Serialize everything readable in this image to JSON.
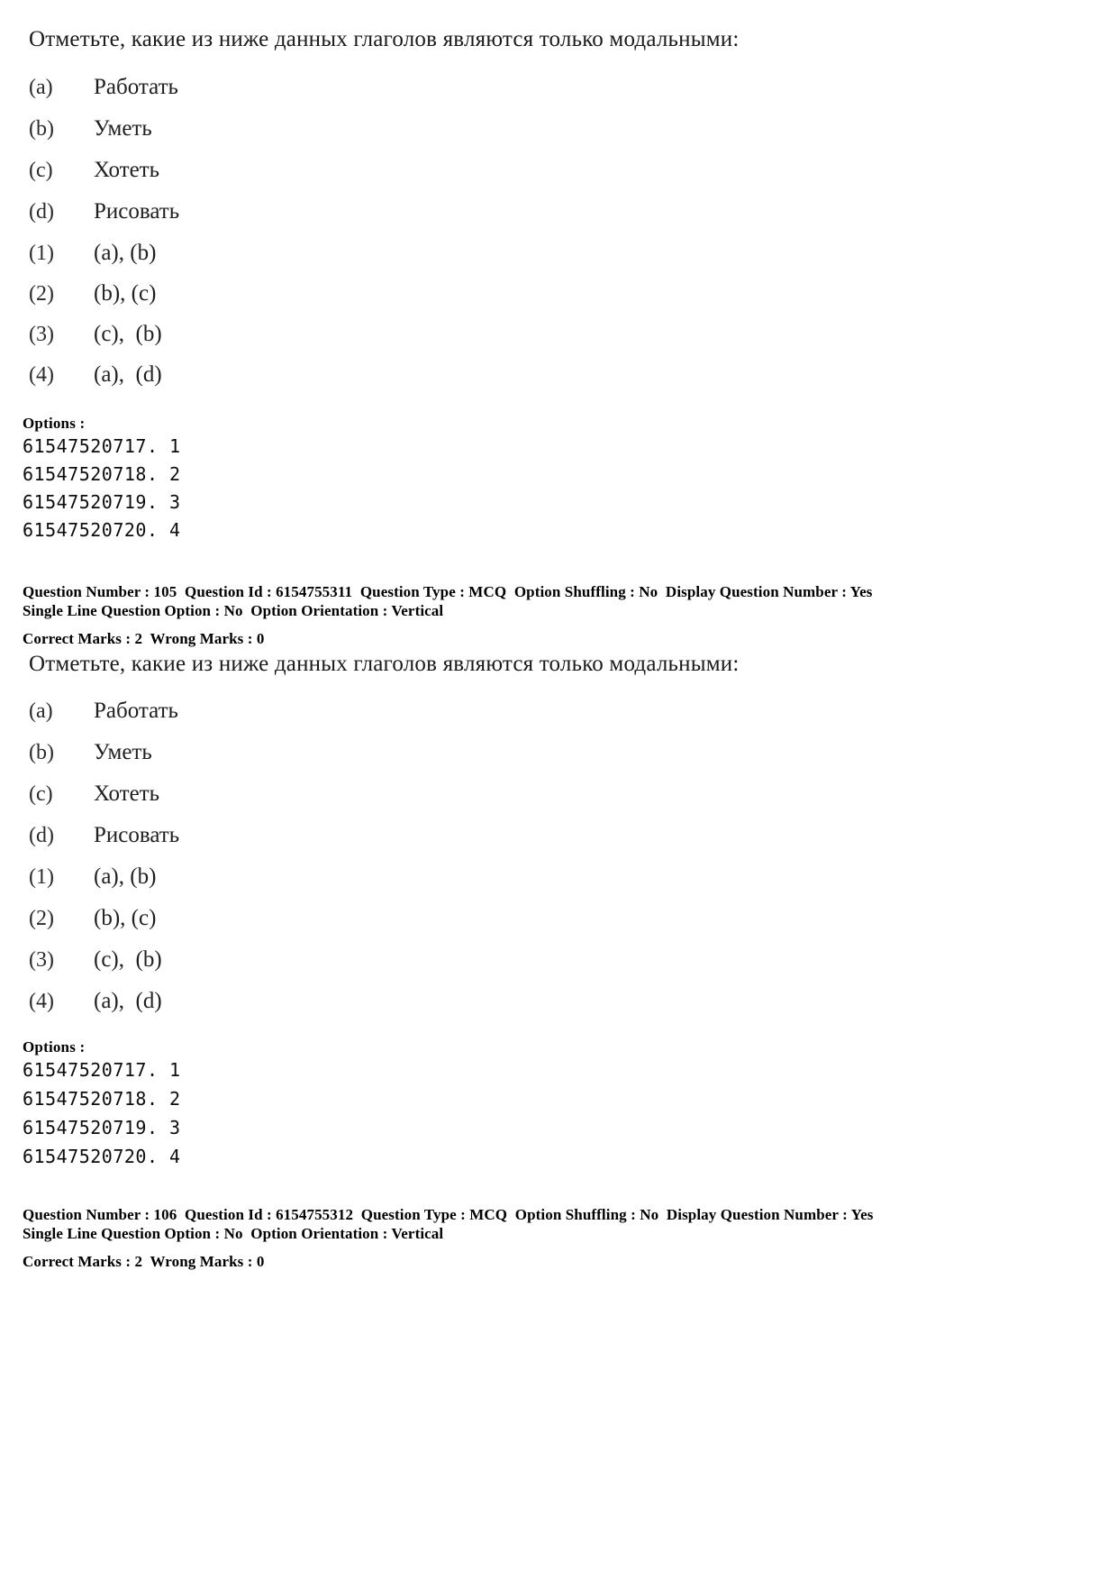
{
  "document": {
    "type": "exam-question-paper",
    "language_sample": "Russian",
    "page_background": "#ffffff",
    "text_color": "#000000"
  },
  "questions": [
    {
      "stem": "Отметьте, какие из ниже данных глаголов являются только модальными:",
      "sub_items": [
        {
          "label": "(a)",
          "text": "Работать"
        },
        {
          "label": "(b)",
          "text": "Уметь"
        },
        {
          "label": "(c)",
          "text": "Хотеть"
        },
        {
          "label": "(d)",
          "text": "Рисовать"
        }
      ],
      "choices": [
        {
          "label": "(1)",
          "text": "(a), (b)"
        },
        {
          "label": "(2)",
          "text": "(b), (c)"
        },
        {
          "label": "(3)",
          "text": "(c),  (b)"
        },
        {
          "label": "(4)",
          "text": "(a),  (d)"
        }
      ],
      "options_header": "Options :",
      "option_ids": [
        "61547520717. 1",
        "61547520718. 2",
        "61547520719. 3",
        "61547520720. 4"
      ],
      "meta": {
        "line1": "Question Number : 105  Question Id : 6154755311  Question Type : MCQ  Option Shuffling : No  Display Question Number : Yes",
        "line2": "Single Line Question Option : No  Option Orientation : Vertical",
        "line3": "Correct Marks : 2  Wrong Marks : 0"
      }
    },
    {
      "stem": "Отметьте, какие из ниже данных глаголов являются только модальными:",
      "sub_items": [
        {
          "label": "(a)",
          "text": "Работать"
        },
        {
          "label": "(b)",
          "text": "Уметь"
        },
        {
          "label": "(c)",
          "text": "Хотеть"
        },
        {
          "label": "(d)",
          "text": "Рисовать"
        }
      ],
      "choices": [
        {
          "label": "(1)",
          "text": "(a), (b)"
        },
        {
          "label": "(2)",
          "text": "(b), (c)"
        },
        {
          "label": "(3)",
          "text": "(c),  (b)"
        },
        {
          "label": "(4)",
          "text": "(a),  (d)"
        }
      ],
      "options_header": "Options :",
      "option_ids": [
        "61547520717. 1",
        "61547520718. 2",
        "61547520719. 3",
        "61547520720. 4"
      ],
      "meta": {
        "line1": "Question Number : 106  Question Id : 6154755312  Question Type : MCQ  Option Shuffling : No  Display Question Number : Yes",
        "line2": "Single Line Question Option : No  Option Orientation : Vertical",
        "line3": "Correct Marks : 2  Wrong Marks : 0"
      }
    }
  ]
}
